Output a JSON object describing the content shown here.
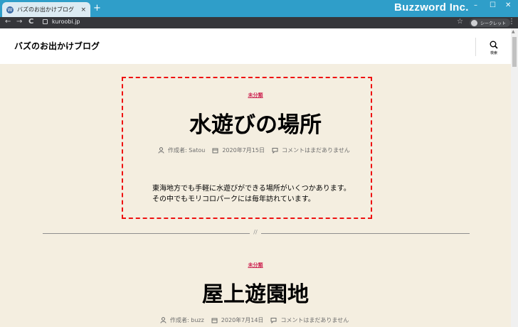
{
  "browser": {
    "tab_title": "バズのお出かけブログ",
    "new_tab": "+",
    "tab_close": "×",
    "url": "kuroobi.jp",
    "incognito_label": "シークレット",
    "watermark": "Buzzword Inc.",
    "window_controls": {
      "minimize": "–",
      "maximize": "☐",
      "close": "✕"
    },
    "nav": {
      "back": "←",
      "forward": "→",
      "reload": "C"
    },
    "bookmark_star": "☆",
    "menu": "⋮"
  },
  "site": {
    "title": "バズのお出かけブログ",
    "search_label": "検索"
  },
  "posts": [
    {
      "category": "未分類",
      "title": "水遊びの場所",
      "author": "作成者: Satou",
      "date": "2020年7月15日",
      "comments": "コメントはまだありません",
      "excerpt": "東海地方でも手軽に水遊びができる場所がいくつかあります。その中でもモリコロパークには毎年訪れています。"
    },
    {
      "category": "未分類",
      "title": "屋上遊園地",
      "author": "作成者: buzz",
      "date": "2020年7月14日",
      "comments": "コメントはまだありません"
    }
  ],
  "separator_mark": "//",
  "colors": {
    "accent": "#cd2653",
    "background": "#f4eee0",
    "titlebar": "#2f9ec9",
    "highlight": "#ee1111"
  }
}
